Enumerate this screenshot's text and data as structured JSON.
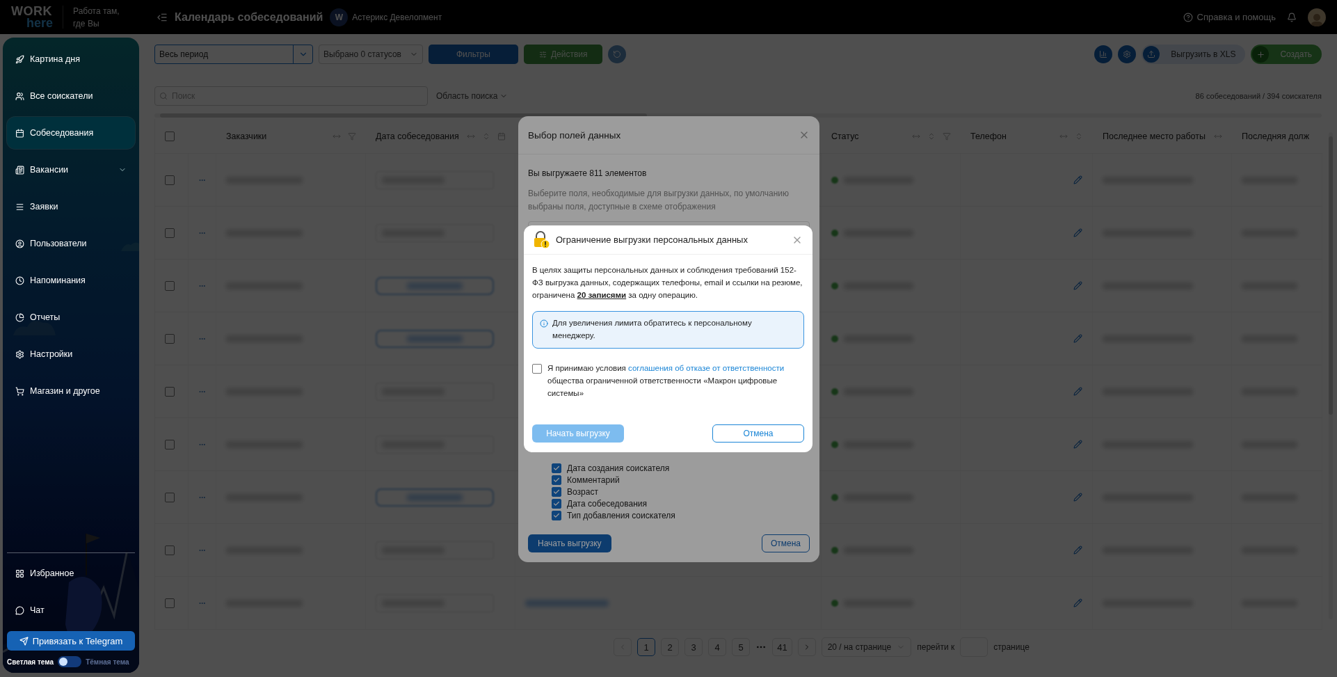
{
  "topbar": {
    "logo_top": "WORK",
    "logo_bottom": "here",
    "slogan": "Работа там, где Вы",
    "title": "Календарь собеседований",
    "company_initials": "W",
    "company": "Астерикс Девелопмент",
    "help": "Справка и помощь"
  },
  "sidebar": {
    "items": [
      {
        "label": "Картина дня",
        "selected": false,
        "expandable": false
      },
      {
        "label": "Все соискатели",
        "selected": false,
        "expandable": false
      },
      {
        "label": "Собеседования",
        "selected": true,
        "expandable": false
      },
      {
        "label": "Вакансии",
        "selected": false,
        "expandable": true
      },
      {
        "label": "Заявки",
        "selected": false,
        "expandable": false
      },
      {
        "label": "Пользователи",
        "selected": false,
        "expandable": false
      },
      {
        "label": "Напоминания",
        "selected": false,
        "expandable": false
      },
      {
        "label": "Отчеты",
        "selected": false,
        "expandable": false
      },
      {
        "label": "Настройки",
        "selected": false,
        "expandable": false
      },
      {
        "label": "Магазин и другое",
        "selected": false,
        "expandable": false
      }
    ],
    "bottom_items": [
      {
        "label": "Избранное"
      },
      {
        "label": "Чат"
      }
    ],
    "telegram_button": "Привязать к Telegram",
    "theme": {
      "light": "Светлая тема",
      "dark": "Тёмная тема",
      "dark_on": false
    }
  },
  "toolbar": {
    "period": "Весь период",
    "statuses": "Выбрано 0 статусов",
    "filters": "Фильтры",
    "actions": {
      "label": "Действия",
      "disabled": true
    },
    "export": "Выгрузить в XLS",
    "create": "Создать"
  },
  "search": {
    "placeholder": "Поиск",
    "scope": "Область поиска",
    "summary": "86 собеседований / 394 соискателя"
  },
  "table": {
    "all_checked": false,
    "columns": [
      {
        "label": "Заказчики"
      },
      {
        "label": "Дата собеседования"
      },
      {
        "label": "Статус"
      },
      {
        "label": "Телефон"
      },
      {
        "label": "Последнее место работы"
      },
      {
        "label": "Последняя долж"
      }
    ],
    "rows": [
      {
        "checked": false,
        "kind": "field"
      },
      {
        "checked": false,
        "kind": "field"
      },
      {
        "checked": false,
        "kind": "button"
      },
      {
        "checked": false,
        "kind": "button"
      },
      {
        "checked": false,
        "kind": "field"
      },
      {
        "checked": false,
        "kind": "field"
      },
      {
        "checked": false,
        "kind": "button"
      },
      {
        "checked": false,
        "kind": "field"
      },
      {
        "checked": false,
        "kind": "field"
      }
    ]
  },
  "pagination": {
    "items": [
      {
        "kind": "page",
        "label": "1",
        "selected": true
      },
      {
        "kind": "page",
        "label": "2",
        "selected": false
      },
      {
        "kind": "page",
        "label": "3",
        "selected": false
      },
      {
        "kind": "page",
        "label": "4",
        "selected": false
      },
      {
        "kind": "page",
        "label": "5",
        "selected": false
      },
      {
        "kind": "ellipsis"
      },
      {
        "kind": "page",
        "label": "41",
        "selected": false
      }
    ],
    "per_page": "20 / на странице",
    "goto": "перейти к",
    "goto_suffix": "странице"
  },
  "fields_dialog": {
    "title": "Выбор полей данных",
    "count": "Вы выгружаете 811 элементов",
    "hint": "Выберите поля, необходимые для выгрузки данных, по умолчанию выбраны поля, доступные в схеме отображения",
    "fields": [
      {
        "label": "Дата создания соискателя",
        "checked": true
      },
      {
        "label": "Комментарий",
        "checked": true
      },
      {
        "label": "Возраст",
        "checked": true
      },
      {
        "label": "Дата собеседования",
        "checked": true
      },
      {
        "label": "Тип добавления соискателя",
        "checked": true
      }
    ],
    "start": "Начать выгрузку",
    "cancel": "Отмена"
  },
  "limit_dialog": {
    "title": "Ограничение выгрузки персональных данных",
    "text": "В целях защиты персональных данных и соблюдения требований 152-ФЗ выгрузка данных, содержащих телефоны, email и ссылки на резюме, ограничена **20 записями** за одну операцию.",
    "info": "Для увеличения лимита обратитесь к персональному менеджеру.",
    "consent": {
      "checked": false,
      "before": "Я принимаю условия ",
      "link": "соглашения об отказе от ответственности",
      "after": " общества ограниченной ответственности «Макрон цифровые системы»"
    },
    "start": {
      "label": "Начать выгрузку",
      "disabled": true
    },
    "cancel": "Отмена"
  }
}
